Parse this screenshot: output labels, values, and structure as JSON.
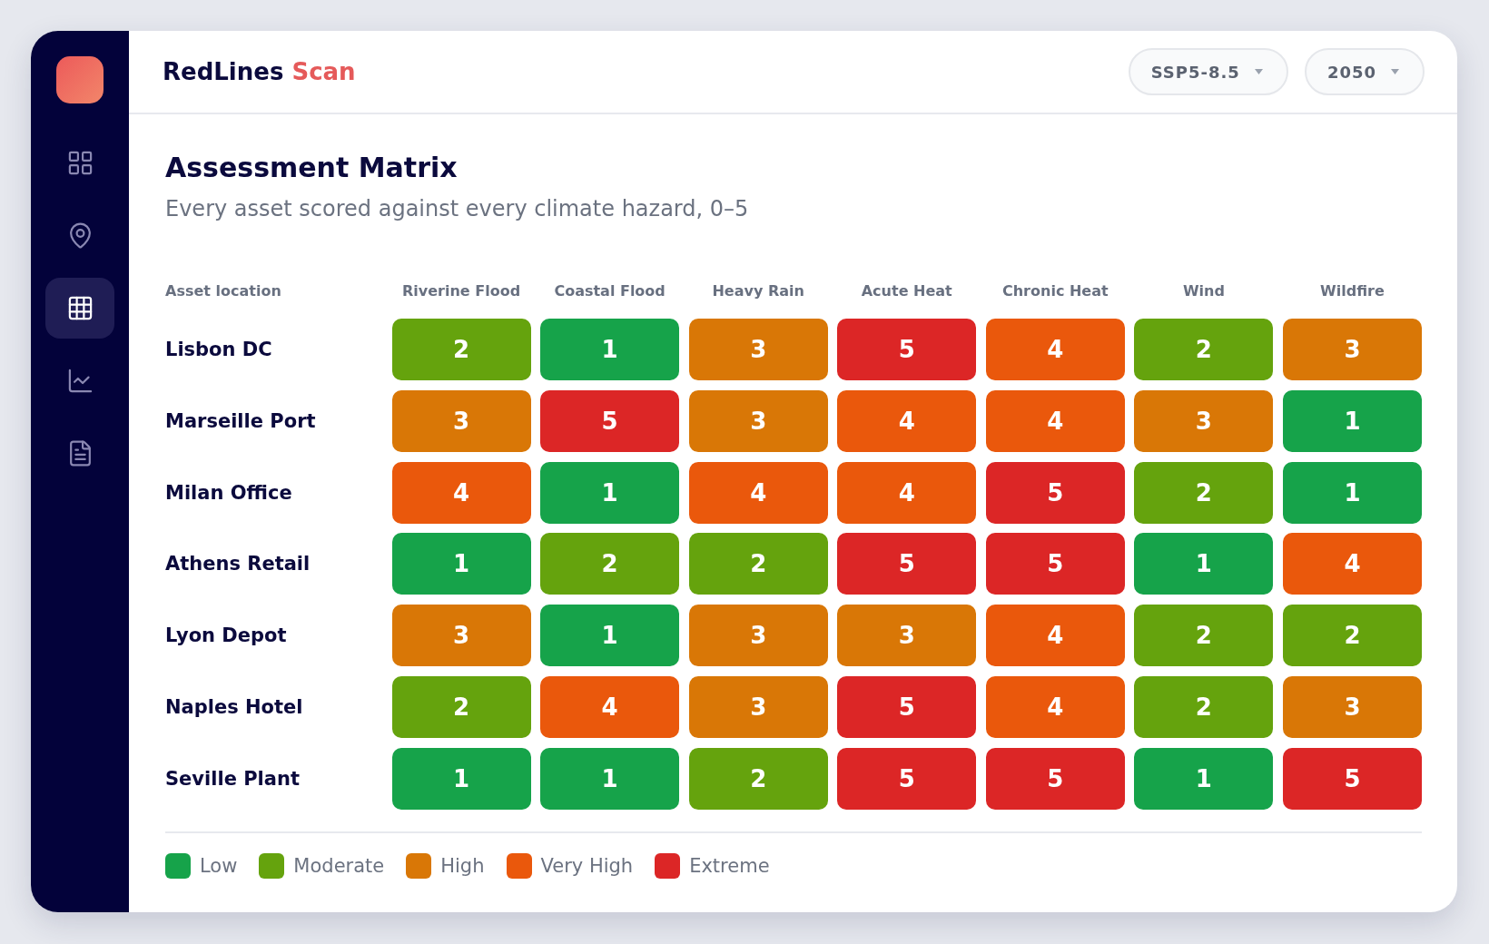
{
  "sidebar": {
    "items": [
      {
        "selected": false
      },
      {
        "selected": false
      },
      {
        "selected": true
      },
      {
        "selected": false
      },
      {
        "selected": false
      }
    ]
  },
  "header": {
    "brand": "RedLines",
    "brand_accent": "Scan",
    "filters": [
      {
        "label": "SSP5-8.5"
      },
      {
        "label": "2050"
      }
    ]
  },
  "page": {
    "title": "Assessment Matrix",
    "subtitle": "Every asset scored against every climate hazard, 0–5"
  },
  "matrix": {
    "row_header": "Asset location",
    "columns": [
      "Riverine Flood",
      "Coastal Flood",
      "Heavy Rain",
      "Acute Heat",
      "Chronic Heat",
      "Wind",
      "Wildfire"
    ],
    "rows": [
      {
        "asset": "Lisbon DC",
        "cells": [
          {
            "value": "2",
            "color": "#65a30d"
          },
          {
            "value": "1",
            "color": "#16a34a"
          },
          {
            "value": "3",
            "color": "#d97706"
          },
          {
            "value": "5",
            "color": "#dc2626"
          },
          {
            "value": "4",
            "color": "#ea580c"
          },
          {
            "value": "2",
            "color": "#65a30d"
          },
          {
            "value": "3",
            "color": "#d97706"
          }
        ]
      },
      {
        "asset": "Marseille Port",
        "cells": [
          {
            "value": "3",
            "color": "#d97706"
          },
          {
            "value": "5",
            "color": "#dc2626"
          },
          {
            "value": "3",
            "color": "#d97706"
          },
          {
            "value": "4",
            "color": "#ea580c"
          },
          {
            "value": "4",
            "color": "#ea580c"
          },
          {
            "value": "3",
            "color": "#d97706"
          },
          {
            "value": "1",
            "color": "#16a34a"
          }
        ]
      },
      {
        "asset": "Milan Office",
        "cells": [
          {
            "value": "4",
            "color": "#ea580c"
          },
          {
            "value": "1",
            "color": "#16a34a"
          },
          {
            "value": "4",
            "color": "#ea580c"
          },
          {
            "value": "4",
            "color": "#ea580c"
          },
          {
            "value": "5",
            "color": "#dc2626"
          },
          {
            "value": "2",
            "color": "#65a30d"
          },
          {
            "value": "1",
            "color": "#16a34a"
          }
        ]
      },
      {
        "asset": "Athens Retail",
        "cells": [
          {
            "value": "1",
            "color": "#16a34a"
          },
          {
            "value": "2",
            "color": "#65a30d"
          },
          {
            "value": "2",
            "color": "#65a30d"
          },
          {
            "value": "5",
            "color": "#dc2626"
          },
          {
            "value": "5",
            "color": "#dc2626"
          },
          {
            "value": "1",
            "color": "#16a34a"
          },
          {
            "value": "4",
            "color": "#ea580c"
          }
        ]
      },
      {
        "asset": "Lyon Depot",
        "cells": [
          {
            "value": "3",
            "color": "#d97706"
          },
          {
            "value": "1",
            "color": "#16a34a"
          },
          {
            "value": "3",
            "color": "#d97706"
          },
          {
            "value": "3",
            "color": "#d97706"
          },
          {
            "value": "4",
            "color": "#ea580c"
          },
          {
            "value": "2",
            "color": "#65a30d"
          },
          {
            "value": "2",
            "color": "#65a30d"
          }
        ]
      },
      {
        "asset": "Naples Hotel",
        "cells": [
          {
            "value": "2",
            "color": "#65a30d"
          },
          {
            "value": "4",
            "color": "#ea580c"
          },
          {
            "value": "3",
            "color": "#d97706"
          },
          {
            "value": "5",
            "color": "#dc2626"
          },
          {
            "value": "4",
            "color": "#ea580c"
          },
          {
            "value": "2",
            "color": "#65a30d"
          },
          {
            "value": "3",
            "color": "#d97706"
          }
        ]
      },
      {
        "asset": "Seville Plant",
        "cells": [
          {
            "value": "1",
            "color": "#16a34a"
          },
          {
            "value": "1",
            "color": "#16a34a"
          },
          {
            "value": "2",
            "color": "#65a30d"
          },
          {
            "value": "5",
            "color": "#dc2626"
          },
          {
            "value": "5",
            "color": "#dc2626"
          },
          {
            "value": "1",
            "color": "#16a34a"
          },
          {
            "value": "5",
            "color": "#dc2626"
          }
        ]
      }
    ]
  },
  "legend": [
    {
      "label": "Low",
      "color": "#16a34a"
    },
    {
      "label": "Moderate",
      "color": "#65a30d"
    },
    {
      "label": "High",
      "color": "#d97706"
    },
    {
      "label": "Very High",
      "color": "#ea580c"
    },
    {
      "label": "Extreme",
      "color": "#dc2626"
    }
  ]
}
